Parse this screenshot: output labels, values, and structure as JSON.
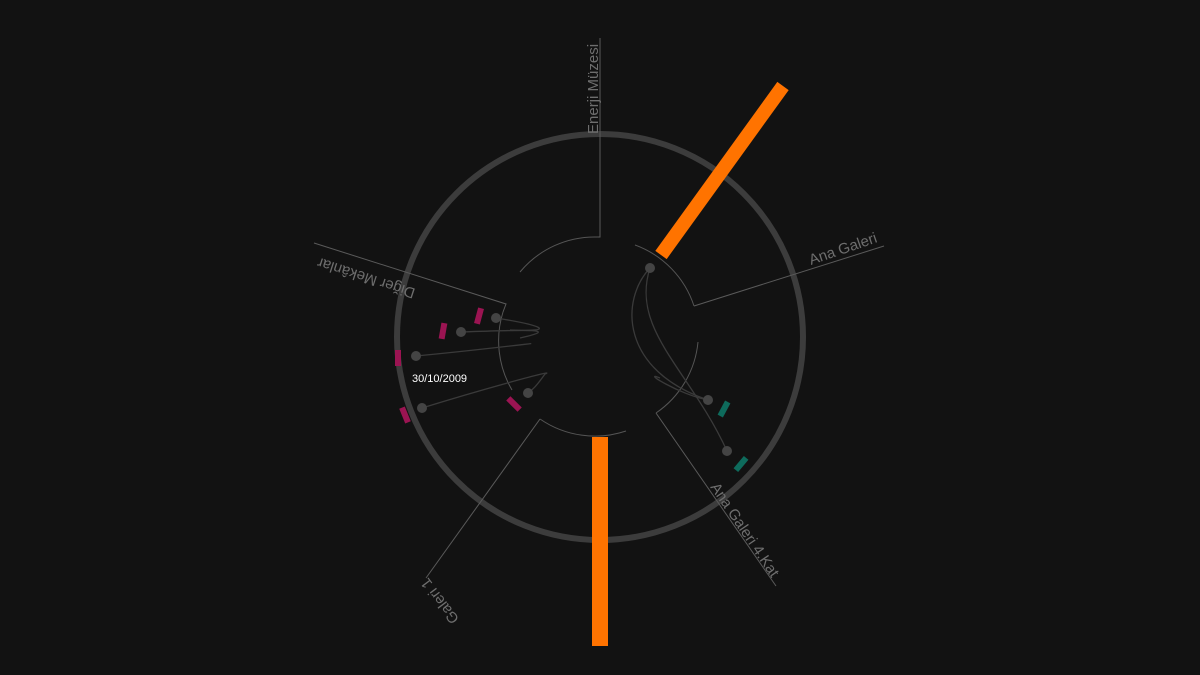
{
  "colors": {
    "background": "#121212",
    "ring": "#3c3c3c",
    "line": "#5a5a5a",
    "label": "#6e6e6e",
    "node": "#444444",
    "accent_orange": "#ff7300",
    "marker_magenta": "#9b1452",
    "marker_teal": "#0e6b5c",
    "date_text": "#ffffff"
  },
  "venues": [
    {
      "id": "enerji-muzesi",
      "label": "Enerji Müzesi"
    },
    {
      "id": "ana-galeri",
      "label": "Ana Galeri"
    },
    {
      "id": "ana-galeri-4-kat",
      "label": "Ana Galeri 4.Kat"
    },
    {
      "id": "galeri-1",
      "label": "Galeri 1"
    },
    {
      "id": "diger-mekanlar",
      "label": "Diğer Mekânlar"
    }
  ],
  "highlight_date": "30/10/2009"
}
